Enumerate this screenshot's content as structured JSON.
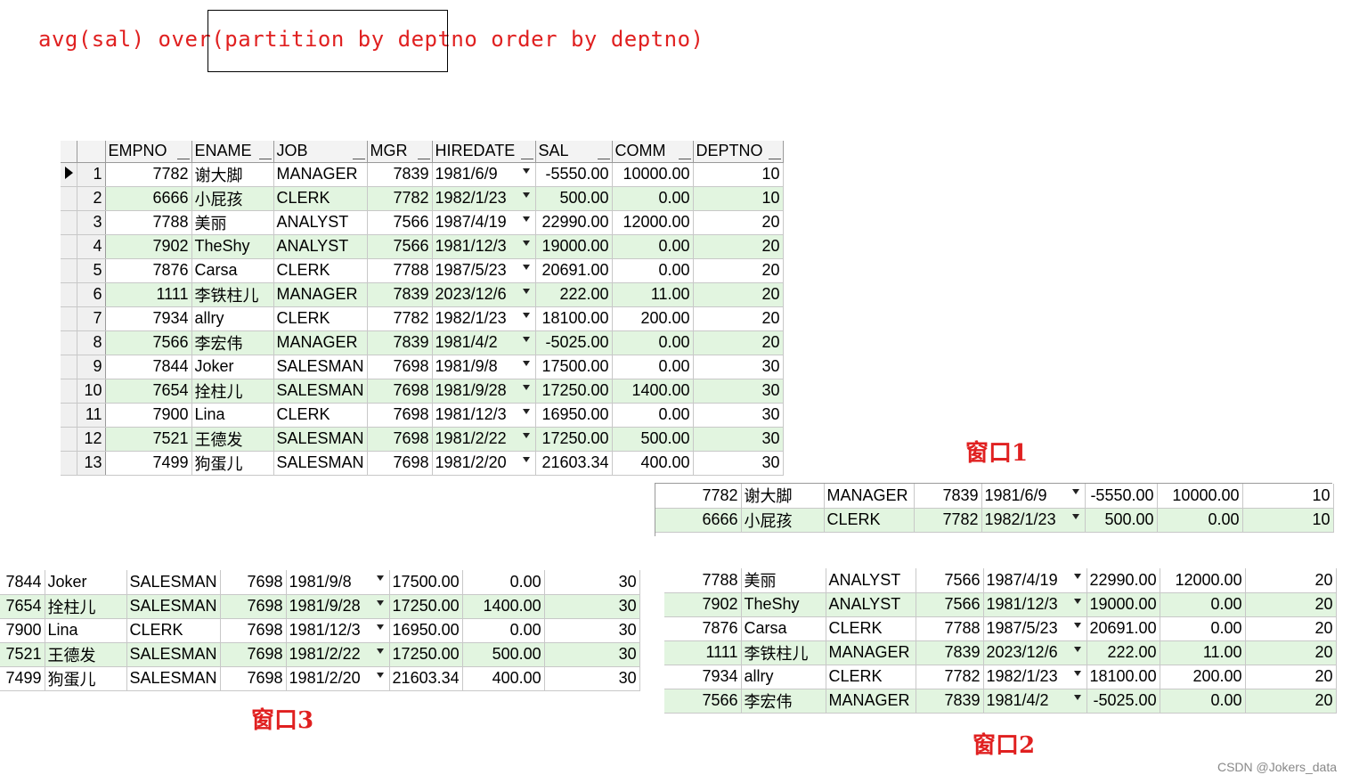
{
  "sql": {
    "text": "avg(sal) over(partition by deptno order by deptno)"
  },
  "main_table": {
    "headers": [
      "EMPNO",
      "ENAME",
      "JOB",
      "MGR",
      "HIREDATE",
      "SAL",
      "COMM",
      "DEPTNO"
    ],
    "rows": [
      [
        "1",
        "7782",
        "谢大脚",
        "MANAGER",
        "7839",
        "1981/6/9",
        "-5550.00",
        "10000.00",
        "10"
      ],
      [
        "2",
        "6666",
        "小屁孩",
        "CLERK",
        "7782",
        "1982/1/23",
        "500.00",
        "0.00",
        "10"
      ],
      [
        "3",
        "7788",
        "美丽",
        "ANALYST",
        "7566",
        "1987/4/19",
        "22990.00",
        "12000.00",
        "20"
      ],
      [
        "4",
        "7902",
        "TheShy",
        "ANALYST",
        "7566",
        "1981/12/3",
        "19000.00",
        "0.00",
        "20"
      ],
      [
        "5",
        "7876",
        "Carsa",
        "CLERK",
        "7788",
        "1987/5/23",
        "20691.00",
        "0.00",
        "20"
      ],
      [
        "6",
        "1111",
        "李铁柱儿",
        "MANAGER",
        "7839",
        "2023/12/6",
        "222.00",
        "11.00",
        "20"
      ],
      [
        "7",
        "7934",
        "allry",
        "CLERK",
        "7782",
        "1982/1/23",
        "18100.00",
        "200.00",
        "20"
      ],
      [
        "8",
        "7566",
        "李宏伟",
        "MANAGER",
        "7839",
        "1981/4/2",
        "-5025.00",
        "0.00",
        "20"
      ],
      [
        "9",
        "7844",
        "Joker",
        "SALESMAN",
        "7698",
        "1981/9/8",
        "17500.00",
        "0.00",
        "30"
      ],
      [
        "10",
        "7654",
        "拴柱儿",
        "SALESMAN",
        "7698",
        "1981/9/28",
        "17250.00",
        "1400.00",
        "30"
      ],
      [
        "11",
        "7900",
        "Lina",
        "CLERK",
        "7698",
        "1981/12/3",
        "16950.00",
        "0.00",
        "30"
      ],
      [
        "12",
        "7521",
        "王德发",
        "SALESMAN",
        "7698",
        "1981/2/22",
        "17250.00",
        "500.00",
        "30"
      ],
      [
        "13",
        "7499",
        "狗蛋儿",
        "SALESMAN",
        "7698",
        "1981/2/20",
        "21603.34",
        "400.00",
        "30"
      ]
    ]
  },
  "window1": {
    "label": "窗口1",
    "rows": [
      [
        "7782",
        "谢大脚",
        "MANAGER",
        "7839",
        "1981/6/9",
        "-5550.00",
        "10000.00",
        "10"
      ],
      [
        "6666",
        "小屁孩",
        "CLERK",
        "7782",
        "1982/1/23",
        "500.00",
        "0.00",
        "10"
      ]
    ]
  },
  "window2": {
    "label": "窗口2",
    "rows": [
      [
        "7788",
        "美丽",
        "ANALYST",
        "7566",
        "1987/4/19",
        "22990.00",
        "12000.00",
        "20"
      ],
      [
        "7902",
        "TheShy",
        "ANALYST",
        "7566",
        "1981/12/3",
        "19000.00",
        "0.00",
        "20"
      ],
      [
        "7876",
        "Carsa",
        "CLERK",
        "7788",
        "1987/5/23",
        "20691.00",
        "0.00",
        "20"
      ],
      [
        "1111",
        "李铁柱儿",
        "MANAGER",
        "7839",
        "2023/12/6",
        "222.00",
        "11.00",
        "20"
      ],
      [
        "7934",
        "allry",
        "CLERK",
        "7782",
        "1982/1/23",
        "18100.00",
        "200.00",
        "20"
      ],
      [
        "7566",
        "李宏伟",
        "MANAGER",
        "7839",
        "1981/4/2",
        "-5025.00",
        "0.00",
        "20"
      ]
    ]
  },
  "window3": {
    "label": "窗口3",
    "rows": [
      [
        "7844",
        "Joker",
        "SALESMAN",
        "7698",
        "1981/9/8",
        "17500.00",
        "0.00",
        "30"
      ],
      [
        "7654",
        "拴柱儿",
        "SALESMAN",
        "7698",
        "1981/9/28",
        "17250.00",
        "1400.00",
        "30"
      ],
      [
        "7900",
        "Lina",
        "CLERK",
        "7698",
        "1981/12/3",
        "16950.00",
        "0.00",
        "30"
      ],
      [
        "7521",
        "王德发",
        "SALESMAN",
        "7698",
        "1981/2/22",
        "17250.00",
        "500.00",
        "30"
      ],
      [
        "7499",
        "狗蛋儿",
        "SALESMAN",
        "7698",
        "1981/2/20",
        "21603.34",
        "400.00",
        "30"
      ]
    ]
  },
  "watermark": "CSDN @Jokers_data",
  "colors": {
    "annotation_red": "#e02020",
    "row_green": "#e2f5e0"
  },
  "icons": {
    "current_row": "triangle-right-icon",
    "date_dropdown": "dropdown-arrow-icon"
  }
}
